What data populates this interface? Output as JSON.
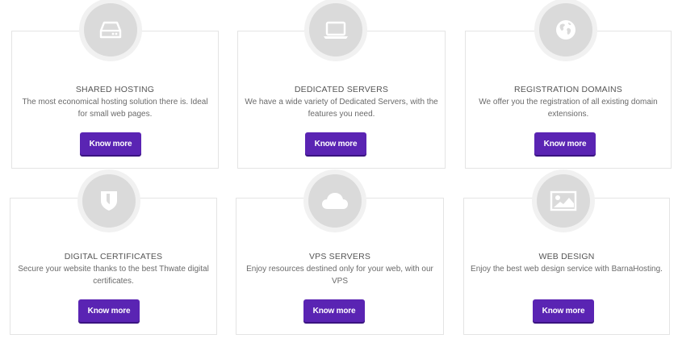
{
  "services": [
    {
      "title": "SHARED HOSTING",
      "description": "The most economical hosting solution there is. Ideal for small web pages.",
      "button_label": "Know more",
      "icon": "hard-drive-icon"
    },
    {
      "title": "DEDICATED SERVERS",
      "description": "We have a wide variety of Dedicated Servers, with the features you need.",
      "button_label": "Know more",
      "icon": "laptop-icon"
    },
    {
      "title": "REGISTRATION DOMAINS",
      "description": "We offer you the registration of all existing domain extensions.",
      "button_label": "Know more",
      "icon": "globe-icon"
    },
    {
      "title": "DIGITAL CERTIFICATES",
      "description": "Secure your website thanks to the best Thwate digital certificates.",
      "button_label": "Know more",
      "icon": "shield-icon"
    },
    {
      "title": "VPS SERVERS",
      "description": "Enjoy resources destined only for your web, with our VPS",
      "button_label": "Know more",
      "icon": "cloud-icon"
    },
    {
      "title": "WEB DESIGN",
      "description": "Enjoy the best web design service with BarnaHosting.",
      "button_label": "Know more",
      "icon": "image-icon"
    }
  ],
  "colors": {
    "button": "#5a24b3",
    "icon_circle": "#dadada",
    "card_border": "#e4e4e4"
  }
}
